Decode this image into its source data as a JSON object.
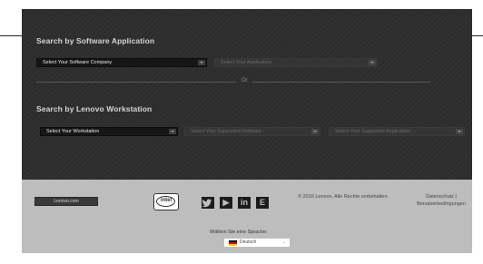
{
  "software_search": {
    "heading": "Search by Software Application",
    "company_select": "Select Your Software Company",
    "application_select": "Select Your Application"
  },
  "divider": {
    "label": "Or"
  },
  "workstation_search": {
    "heading": "Search by Lenovo Workstation",
    "workstation_select": "Select Your Workstation",
    "software_select": "Select Your Supported Software",
    "application_select": "Select Your Supported Application"
  },
  "footer": {
    "site_link": "Lenovo.com",
    "intel_logo": "intel",
    "social": {
      "twitter": "twitter-icon",
      "youtube": "youtube-icon",
      "linkedin": "linkedin-icon",
      "other": "social-icon"
    },
    "copyright": "© 2016 Lenovo. Alle Rechte vorbehalten.",
    "privacy_link": "Datenschutz |",
    "terms_link": "Benutzerbedingungen",
    "language_label": "Wählen Sie eine Sprache:",
    "language_selected": "Deutsch"
  }
}
